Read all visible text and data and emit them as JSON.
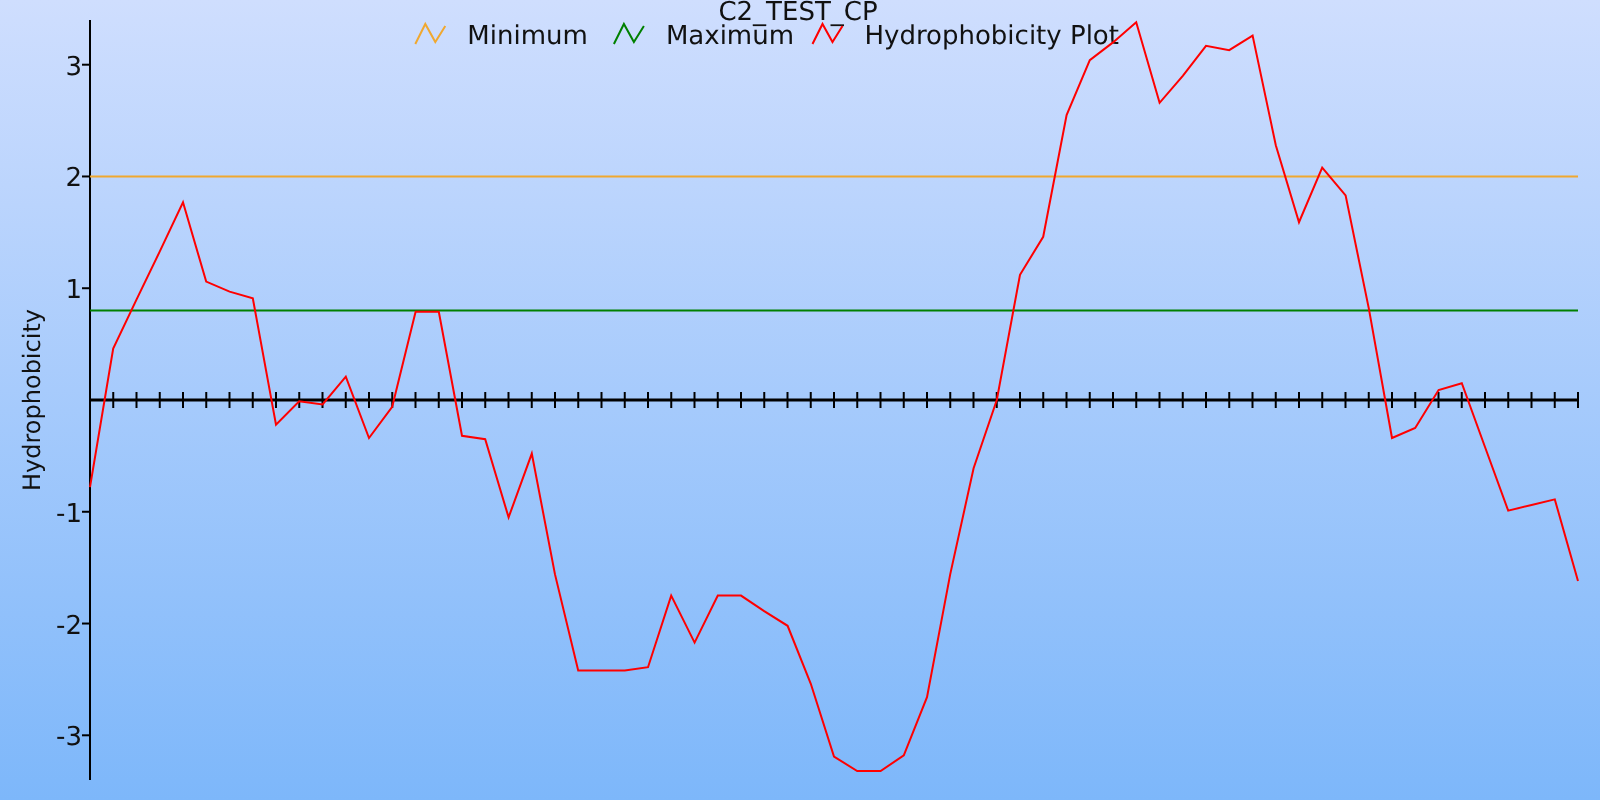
{
  "chart": {
    "chart_data": {
      "type": "line",
      "title": "C2_TEST_CP",
      "ylabel": "Hydrophobicity",
      "legend": true,
      "ylim": [
        -3.4,
        3.4
      ],
      "yticks": [
        -3,
        -2,
        -1,
        1,
        2,
        3
      ],
      "series": [
        {
          "name": "Minimum",
          "color": "#f0a830",
          "values": [
            2,
            2,
            2,
            2,
            2,
            2,
            2,
            2,
            2,
            2,
            2,
            2,
            2,
            2,
            2,
            2,
            2,
            2,
            2,
            2,
            2,
            2,
            2,
            2,
            2,
            2,
            2,
            2,
            2,
            2,
            2,
            2,
            2,
            2,
            2,
            2,
            2,
            2,
            2,
            2,
            2,
            2,
            2,
            2,
            2,
            2,
            2,
            2,
            2,
            2,
            2,
            2,
            2,
            2,
            2,
            2,
            2,
            2,
            2,
            2,
            2,
            2,
            2,
            2,
            2
          ]
        },
        {
          "name": "Maximum",
          "color": "#008000",
          "values": [
            0.8,
            0.8,
            0.8,
            0.8,
            0.8,
            0.8,
            0.8,
            0.8,
            0.8,
            0.8,
            0.8,
            0.8,
            0.8,
            0.8,
            0.8,
            0.8,
            0.8,
            0.8,
            0.8,
            0.8,
            0.8,
            0.8,
            0.8,
            0.8,
            0.8,
            0.8,
            0.8,
            0.8,
            0.8,
            0.8,
            0.8,
            0.8,
            0.8,
            0.8,
            0.8,
            0.8,
            0.8,
            0.8,
            0.8,
            0.8,
            0.8,
            0.8,
            0.8,
            0.8,
            0.8,
            0.8,
            0.8,
            0.8,
            0.8,
            0.8,
            0.8,
            0.8,
            0.8,
            0.8,
            0.8,
            0.8,
            0.8,
            0.8,
            0.8,
            0.8,
            0.8,
            0.8,
            0.8,
            0.8,
            0.8
          ]
        },
        {
          "name": "Hydrophobicity Plot",
          "color": "#ff0000",
          "values": [
            -0.78,
            0.46,
            0.9,
            1.33,
            1.77,
            1.06,
            0.97,
            0.91,
            -0.22,
            -0.01,
            -0.04,
            0.21,
            -0.34,
            -0.06,
            0.79,
            0.79,
            -0.32,
            -0.35,
            -1.05,
            -0.48,
            -1.56,
            -2.42,
            -2.42,
            -2.42,
            -2.39,
            -1.75,
            -2.17,
            -1.75,
            -1.75,
            -1.89,
            -2.02,
            -2.54,
            -3.19,
            -3.32,
            -3.32,
            -3.18,
            -2.66,
            -1.56,
            -0.61,
            0.0,
            1.12,
            1.46,
            2.55,
            3.04,
            3.2,
            3.38,
            2.66,
            2.9,
            3.17,
            3.13,
            3.26,
            2.28,
            1.59,
            2.08,
            1.83,
            0.82,
            -0.34,
            -0.25,
            0.09,
            0.15,
            -0.42,
            -0.99,
            -0.94,
            -0.89,
            -1.62
          ]
        }
      ]
    }
  }
}
